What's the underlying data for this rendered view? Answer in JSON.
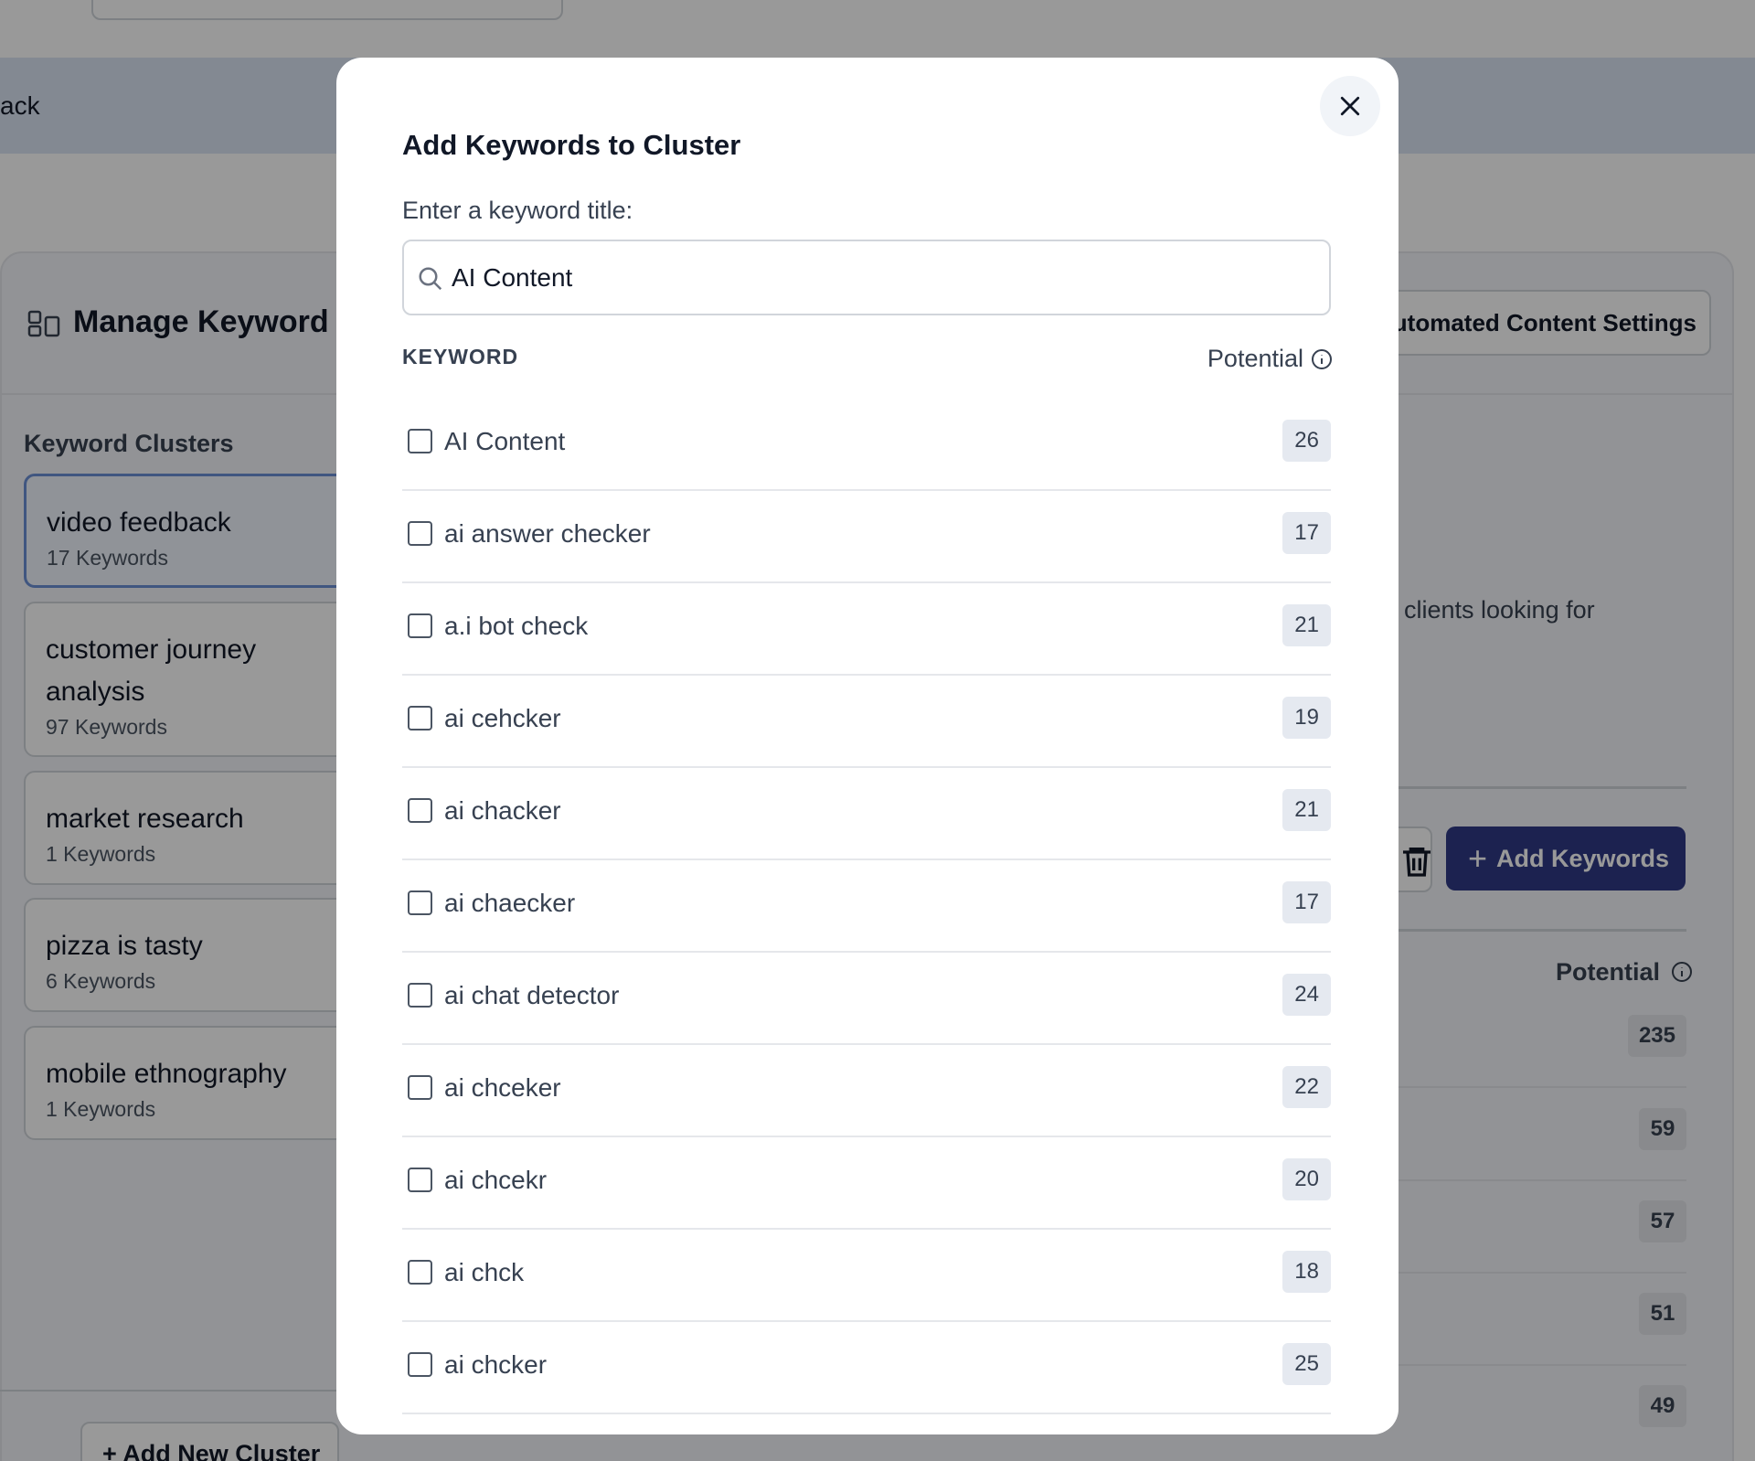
{
  "background": {
    "banner_text": "ack",
    "header_title": "Manage Keyword C",
    "settings_label": "utomated Content Settings",
    "clusters_label": "Keyword Clusters",
    "clusters": [
      {
        "name": "video feedback",
        "count": "17 Keywords",
        "active": true
      },
      {
        "name": "customer journey analysis",
        "count": "97 Keywords",
        "active": false
      },
      {
        "name": "market research",
        "count": "1 Keywords",
        "active": false
      },
      {
        "name": "pizza is tasty",
        "count": "6 Keywords",
        "active": false
      },
      {
        "name": "mobile ethnography",
        "count": "1 Keywords",
        "active": false
      }
    ],
    "add_cluster_label": "+ Add New Cluster",
    "description_fragment": "clients looking for",
    "add_keywords_label": "Add Keywords",
    "potential_label": "Potential",
    "potential_values": [
      "235",
      "59",
      "57",
      "51",
      "49"
    ],
    "accent_color": "#303a86"
  },
  "modal": {
    "title": "Add Keywords to Cluster",
    "field_label": "Enter a keyword title:",
    "search_value": "AI Content",
    "col_keyword": "KEYWORD",
    "col_potential": "Potential",
    "keywords": [
      {
        "label": "AI Content",
        "potential": "26"
      },
      {
        "label": "ai answer checker",
        "potential": "17"
      },
      {
        "label": "a.i bot check",
        "potential": "21"
      },
      {
        "label": "ai cehcker",
        "potential": "19"
      },
      {
        "label": "ai chacker",
        "potential": "21"
      },
      {
        "label": "ai chaecker",
        "potential": "17"
      },
      {
        "label": "ai chat detector",
        "potential": "24"
      },
      {
        "label": "ai chceker",
        "potential": "22"
      },
      {
        "label": "ai chcekr",
        "potential": "20"
      },
      {
        "label": "ai chck",
        "potential": "18"
      },
      {
        "label": "ai chcker",
        "potential": "25"
      }
    ]
  }
}
